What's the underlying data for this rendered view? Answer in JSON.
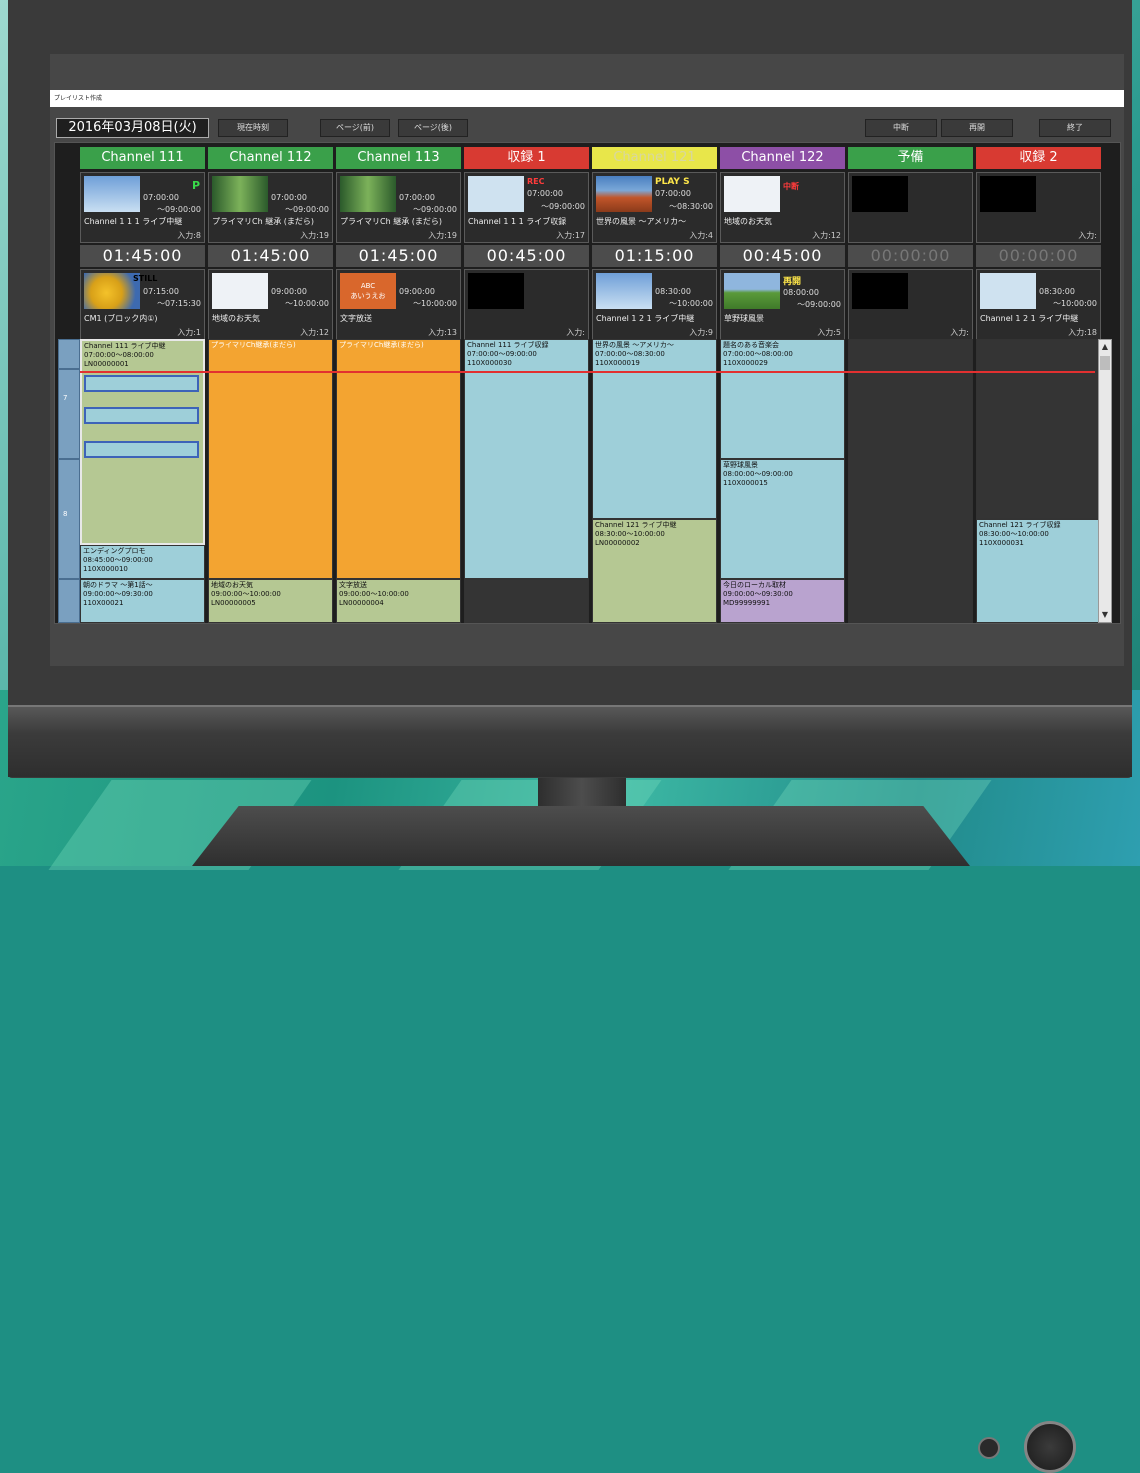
{
  "window": {
    "title": "プレイリスト作成"
  },
  "toolbar": {
    "date": "2016年03月08日(火)",
    "now": "現在時刻",
    "prev": "ページ(前)",
    "next": "ページ(後)",
    "pause": "中断",
    "resume": "再開",
    "exit": "終了"
  },
  "channels": [
    {
      "name": "Channel 111",
      "color": "#3aa04a",
      "top": {
        "start": "07:00:00",
        "end": "～09:00:00",
        "title": "Channel 1 1 1 ライブ中継",
        "input": "入力:8",
        "badge": "P",
        "badge_color": "#39d94a"
      },
      "remaining": "01:45:00",
      "bottom": {
        "start": "07:15:00",
        "end": "～07:15:30",
        "title": "CM1 (ブロック内①)",
        "input": "入力:1",
        "badge": "STILL",
        "badge_color": "#ffe74a"
      }
    },
    {
      "name": "Channel 112",
      "color": "#3aa04a",
      "top": {
        "start": "07:00:00",
        "end": "～09:00:00",
        "title": "プライマリCh 継承 (まだら)",
        "input": "入力:19"
      },
      "remaining": "01:45:00",
      "bottom": {
        "start": "09:00:00",
        "end": "～10:00:00",
        "title": "地域のお天気",
        "input": "入力:12"
      }
    },
    {
      "name": "Channel 113",
      "color": "#3aa04a",
      "top": {
        "start": "07:00:00",
        "end": "～09:00:00",
        "title": "プライマリCh 継承 (まだら)",
        "input": "入力:19"
      },
      "remaining": "01:45:00",
      "bottom": {
        "start": "09:00:00",
        "end": "～10:00:00",
        "title": "文字放送",
        "input": "入力:13",
        "thumb_text1": "ABC",
        "thumb_text2": "あいうえお"
      }
    },
    {
      "name": "収録 1",
      "color": "#d83a32",
      "top": {
        "start": "07:00:00",
        "end": "～09:00:00",
        "title": "Channel 1 1 1 ライブ収録",
        "input": "入力:17",
        "badge": "REC",
        "badge_color": "#ff3b3b"
      },
      "remaining": "00:45:00",
      "bottom": {
        "input": "入力:"
      }
    },
    {
      "name": "Channel 121",
      "color": "#e8e64a",
      "top": {
        "start": "07:00:00",
        "end": "～08:30:00",
        "title": "世界の風景 ～アメリカ～",
        "input": "入力:4",
        "badge": "PLAY  S",
        "badge_color": "#ffe74a"
      },
      "remaining": "01:15:00",
      "bottom": {
        "start": "08:30:00",
        "end": "～10:00:00",
        "title": "Channel 1 2 1 ライブ中継",
        "input": "入力:9"
      }
    },
    {
      "name": "Channel 122",
      "color": "#8d4fa6",
      "top": {
        "start": "",
        "end": "",
        "title": "地域のお天気",
        "input": "入力:12",
        "badge": "中断",
        "badge_color": "#ff3b3b"
      },
      "remaining": "00:45:00",
      "bottom": {
        "start": "08:00:00",
        "end": "～09:00:00",
        "title": "草野球風景",
        "input": "入力:5",
        "badge": "再開",
        "badge_color": "#ffe74a"
      }
    },
    {
      "name": "予備",
      "color": "#3aa04a",
      "top": {
        "input": ""
      },
      "remaining": "00:00:00",
      "bottom": {
        "input": "入力:"
      }
    },
    {
      "name": "収録 2",
      "color": "#d83a32",
      "top": {
        "input": "入力:"
      },
      "remaining": "00:00:00",
      "bottom": {
        "start": "08:30:00",
        "end": "～10:00:00",
        "title": "Channel 1 2 1 ライブ中継",
        "input": "入力:18"
      }
    }
  ],
  "hours": [
    "7",
    "8"
  ],
  "blocks": {
    "c0": [
      {
        "title": "Channel 111 ライブ中継",
        "time": "07:00:00～08:00:00",
        "id": "LN00000001"
      },
      {
        "title": "エンディングプロモ",
        "time": "08:45:00～09:00:00",
        "id": "110X000010"
      },
      {
        "title": "朝のドラマ ～第1話～",
        "time": "09:00:00～09:30:00",
        "id": "110X00021"
      }
    ],
    "c1": [
      {
        "title": "プライマリCh継承(まだら)"
      },
      {
        "title": "地域のお天気",
        "time": "09:00:00～10:00:00",
        "id": "LN00000005"
      }
    ],
    "c2": [
      {
        "title": "プライマリCh継承(まだら)"
      },
      {
        "title": "文字放送",
        "time": "09:00:00～10:00:00",
        "id": "LN00000004"
      }
    ],
    "c3": [
      {
        "title": "Channel 111 ライブ収録",
        "time": "07:00:00～09:00:00",
        "id": "110X000030"
      }
    ],
    "c4": [
      {
        "title": "世界の風景 ～アメリカ～",
        "time": "07:00:00～08:30:00",
        "id": "110X000019"
      },
      {
        "title": "Channel 121 ライブ中継",
        "time": "08:30:00～10:00:00",
        "id": "LN00000002"
      }
    ],
    "c5": [
      {
        "title": "題名のある音楽会",
        "time": "07:00:00～08:00:00",
        "id": "110X000029"
      },
      {
        "title": "草野球風景",
        "time": "08:00:00～09:00:00",
        "id": "110X000015"
      },
      {
        "title": "今日のローカル取材",
        "time": "09:00:00～09:30:00",
        "id": "MD99999991"
      }
    ],
    "c7": [
      {
        "title": "Channel 121 ライブ収録",
        "time": "08:30:00～10:00:00",
        "id": "110X000031"
      }
    ]
  },
  "colors": {
    "green_block": "#b5c893",
    "orange_block": "#f3a431",
    "blue_block": "#9ecfd9",
    "purple_block": "#b9a3cf",
    "now_line": "#e23030"
  }
}
